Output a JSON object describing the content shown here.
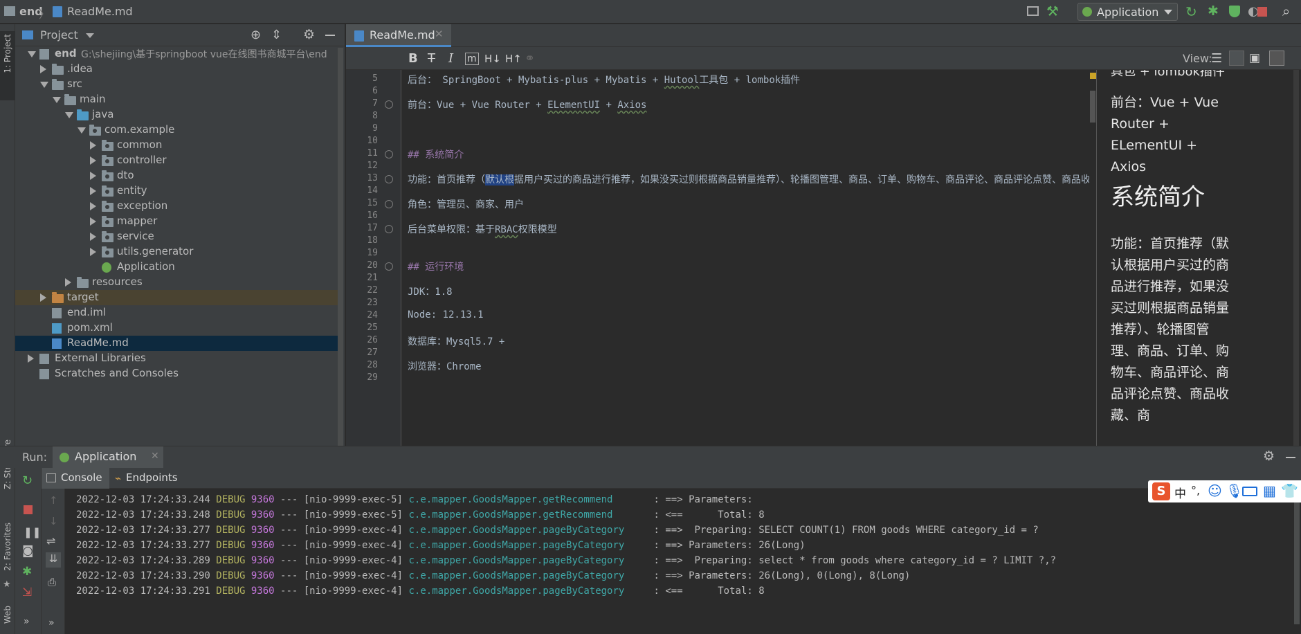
{
  "breadcrumb": {
    "project": "end",
    "file": "ReadMe.md"
  },
  "run_config": {
    "name": "Application"
  },
  "left_strip": {
    "project_tab": "1: Project",
    "structure_tab": "Z: Structure",
    "favorites_tab": "2: Favorites",
    "web_tab": "Web"
  },
  "project_panel": {
    "title": "Project",
    "tree": [
      {
        "label": "end",
        "suffix": "G:\\shejiing\\基于springboot vue在线图书商城平台\\end",
        "level": 0,
        "arrow": "down",
        "icon": "module"
      },
      {
        "label": ".idea",
        "level": 1,
        "arrow": "right",
        "icon": "folder"
      },
      {
        "label": "src",
        "level": 1,
        "arrow": "down",
        "icon": "folder"
      },
      {
        "label": "main",
        "level": 2,
        "arrow": "down",
        "icon": "folder"
      },
      {
        "label": "java",
        "level": 3,
        "arrow": "down",
        "icon": "folder-blue"
      },
      {
        "label": "com.example",
        "level": 4,
        "arrow": "down",
        "icon": "package"
      },
      {
        "label": "common",
        "level": 5,
        "arrow": "right",
        "icon": "package"
      },
      {
        "label": "controller",
        "level": 5,
        "arrow": "right",
        "icon": "package"
      },
      {
        "label": "dto",
        "level": 5,
        "arrow": "right",
        "icon": "package"
      },
      {
        "label": "entity",
        "level": 5,
        "arrow": "right",
        "icon": "package"
      },
      {
        "label": "exception",
        "level": 5,
        "arrow": "right",
        "icon": "package"
      },
      {
        "label": "mapper",
        "level": 5,
        "arrow": "right",
        "icon": "package"
      },
      {
        "label": "service",
        "level": 5,
        "arrow": "right",
        "icon": "package"
      },
      {
        "label": "utils.generator",
        "level": 5,
        "arrow": "right",
        "icon": "package"
      },
      {
        "label": "Application",
        "level": 5,
        "arrow": "none",
        "icon": "spring-class"
      },
      {
        "label": "resources",
        "level": 3,
        "arrow": "right",
        "icon": "folder-res"
      },
      {
        "label": "target",
        "level": 1,
        "arrow": "right",
        "icon": "folder-orange"
      },
      {
        "label": "end.iml",
        "level": 1,
        "arrow": "none",
        "icon": "iml"
      },
      {
        "label": "pom.xml",
        "level": 1,
        "arrow": "none",
        "icon": "maven"
      },
      {
        "label": "ReadMe.md",
        "level": 1,
        "arrow": "none",
        "icon": "md"
      },
      {
        "label": "External Libraries",
        "level": 0,
        "arrow": "right",
        "icon": "libs"
      },
      {
        "label": "Scratches and Consoles",
        "level": 0,
        "arrow": "none",
        "icon": "scratches"
      }
    ]
  },
  "editor": {
    "tab": "ReadMe.md",
    "view_label": "View:",
    "lines": [
      {
        "n": "5",
        "parts": [
          [
            "后台：  SpringBoot + Mybatis-plus + Mybatis + ",
            ""
          ],
          [
            "Hutool",
            "squig"
          ],
          [
            "工具包 + lombok插件",
            ""
          ]
        ]
      },
      {
        "n": "6",
        "parts": []
      },
      {
        "n": "7",
        "parts": [
          [
            "前台：Vue + Vue Router + ",
            ""
          ],
          [
            "ELementUI",
            "squig"
          ],
          [
            " + ",
            ""
          ],
          [
            "Axios",
            "squig"
          ]
        ]
      },
      {
        "n": "8",
        "parts": []
      },
      {
        "n": "9",
        "parts": []
      },
      {
        "n": "10",
        "parts": []
      },
      {
        "n": "11",
        "parts": [
          [
            "## 系统简介",
            "head"
          ]
        ]
      },
      {
        "n": "12",
        "parts": []
      },
      {
        "n": "13",
        "parts": [
          [
            "功能：首页推荐（",
            ""
          ],
          [
            "默认根",
            "sel"
          ],
          [
            "据用户买过的商品进行推荐，如果没买过则根据商品销量推荐）、轮播图管理、商品、订单、购物车、商品评论、商品评论点赞、商品收藏、",
            ""
          ]
        ]
      },
      {
        "n": "14",
        "parts": []
      },
      {
        "n": "15",
        "parts": [
          [
            "角色：管理员、商家、用户",
            ""
          ]
        ]
      },
      {
        "n": "16",
        "parts": []
      },
      {
        "n": "17",
        "parts": [
          [
            "后台菜单权限：基于",
            ""
          ],
          [
            "RBAC",
            "squig"
          ],
          [
            "权限模型",
            ""
          ]
        ]
      },
      {
        "n": "18",
        "parts": []
      },
      {
        "n": "19",
        "parts": []
      },
      {
        "n": "20",
        "parts": [
          [
            "## 运行环境",
            "head"
          ]
        ]
      },
      {
        "n": "21",
        "parts": []
      },
      {
        "n": "22",
        "parts": [
          [
            "JDK：1.8",
            ""
          ]
        ]
      },
      {
        "n": "23",
        "parts": []
      },
      {
        "n": "24",
        "parts": [
          [
            "Node:  12.13.1",
            ""
          ]
        ]
      },
      {
        "n": "25",
        "parts": []
      },
      {
        "n": "26",
        "parts": [
          [
            "数据库：Mysql5.7 +",
            ""
          ]
        ]
      },
      {
        "n": "27",
        "parts": []
      },
      {
        "n": "28",
        "parts": [
          [
            "浏览器：Chrome",
            ""
          ]
        ]
      },
      {
        "n": "29",
        "parts": []
      }
    ]
  },
  "preview": {
    "top_fragment": "具包 + lombok插件",
    "frontend": "前台：Vue + Vue Router + ELementUI + Axios",
    "heading": "系统简介",
    "function_text": "功能：首页推荐（默认根据用户买过的商品进行推荐，如果没买过则根据商品销量推荐）、轮播图管理、商品、订单、购物车、商品评论、商品评论点赞、商品收藏、商"
  },
  "run_panel": {
    "run_label": "Run:",
    "run_tab": "Application",
    "console_tab": "Console",
    "endpoints_tab": "Endpoints",
    "log": [
      {
        "ts": "2022-12-03 17:24:33.244",
        "level": "DEBUG",
        "pid": "9360",
        "thread": "[nio-9999-exec-5]",
        "logger": "c.e.mapper.GoodsMapper.getRecommend      ",
        "msg": ": ==> Parameters: "
      },
      {
        "ts": "2022-12-03 17:24:33.248",
        "level": "DEBUG",
        "pid": "9360",
        "thread": "[nio-9999-exec-5]",
        "logger": "c.e.mapper.GoodsMapper.getRecommend      ",
        "msg": ": <==      Total: 8"
      },
      {
        "ts": "2022-12-03 17:24:33.277",
        "level": "DEBUG",
        "pid": "9360",
        "thread": "[nio-9999-exec-4]",
        "logger": "c.e.mapper.GoodsMapper.pageByCategory    ",
        "msg": ": ==>  Preparing: SELECT COUNT(1) FROM goods WHERE category_id = ?"
      },
      {
        "ts": "2022-12-03 17:24:33.277",
        "level": "DEBUG",
        "pid": "9360",
        "thread": "[nio-9999-exec-4]",
        "logger": "c.e.mapper.GoodsMapper.pageByCategory    ",
        "msg": ": ==> Parameters: 26(Long)"
      },
      {
        "ts": "2022-12-03 17:24:33.289",
        "level": "DEBUG",
        "pid": "9360",
        "thread": "[nio-9999-exec-4]",
        "logger": "c.e.mapper.GoodsMapper.pageByCategory    ",
        "msg": ": ==>  Preparing: select * from goods where category_id = ? LIMIT ?,?"
      },
      {
        "ts": "2022-12-03 17:24:33.290",
        "level": "DEBUG",
        "pid": "9360",
        "thread": "[nio-9999-exec-4]",
        "logger": "c.e.mapper.GoodsMapper.pageByCategory    ",
        "msg": ": ==> Parameters: 26(Long), 0(Long), 8(Long)"
      },
      {
        "ts": "2022-12-03 17:24:33.291",
        "level": "DEBUG",
        "pid": "9360",
        "thread": "[nio-9999-exec-4]",
        "logger": "c.e.mapper.GoodsMapper.pageByCategory    ",
        "msg": ": <==      Total: 8"
      }
    ]
  },
  "ime": {
    "lang": "中",
    "punct": "°,"
  },
  "colors": {
    "accent": "#4a88c7",
    "bg": "#2b2b2b",
    "panel": "#3c3f41",
    "heading": "#9876aa",
    "debug": "#b3b360",
    "logger": "#3fa8a8"
  }
}
